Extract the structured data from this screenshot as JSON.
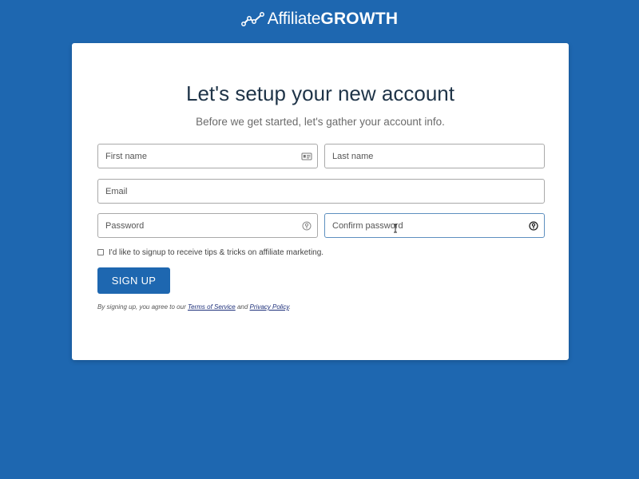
{
  "brand": {
    "name_light": "Affiliate",
    "name_bold": "GROWTH",
    "icon": "trend-line-icon"
  },
  "form": {
    "title": "Let's setup your new account",
    "subtitle": "Before we get started, let's gather your account info.",
    "first_name": {
      "placeholder": "First name",
      "value": "",
      "icon": "contact-card-icon"
    },
    "last_name": {
      "placeholder": "Last name",
      "value": ""
    },
    "email": {
      "placeholder": "Email",
      "value": ""
    },
    "password": {
      "placeholder": "Password",
      "value": "",
      "icon": "password-key-icon"
    },
    "confirm_password": {
      "placeholder": "Confirm password",
      "value": "",
      "icon": "password-key-icon"
    },
    "newsletter_label": "I'd like to signup to receive tips & tricks on affiliate marketing.",
    "newsletter_checked": false,
    "submit_label": "SIGN UP",
    "terms_prefix": "By signing up, you agree to our",
    "terms_link": "Terms of Service",
    "terms_and": "and",
    "privacy_link": "Privacy Policy",
    "terms_suffix": "."
  },
  "colors": {
    "background": "#1e67b0",
    "card": "#ffffff",
    "button": "#1e67b0",
    "link": "#1d2f7a"
  }
}
